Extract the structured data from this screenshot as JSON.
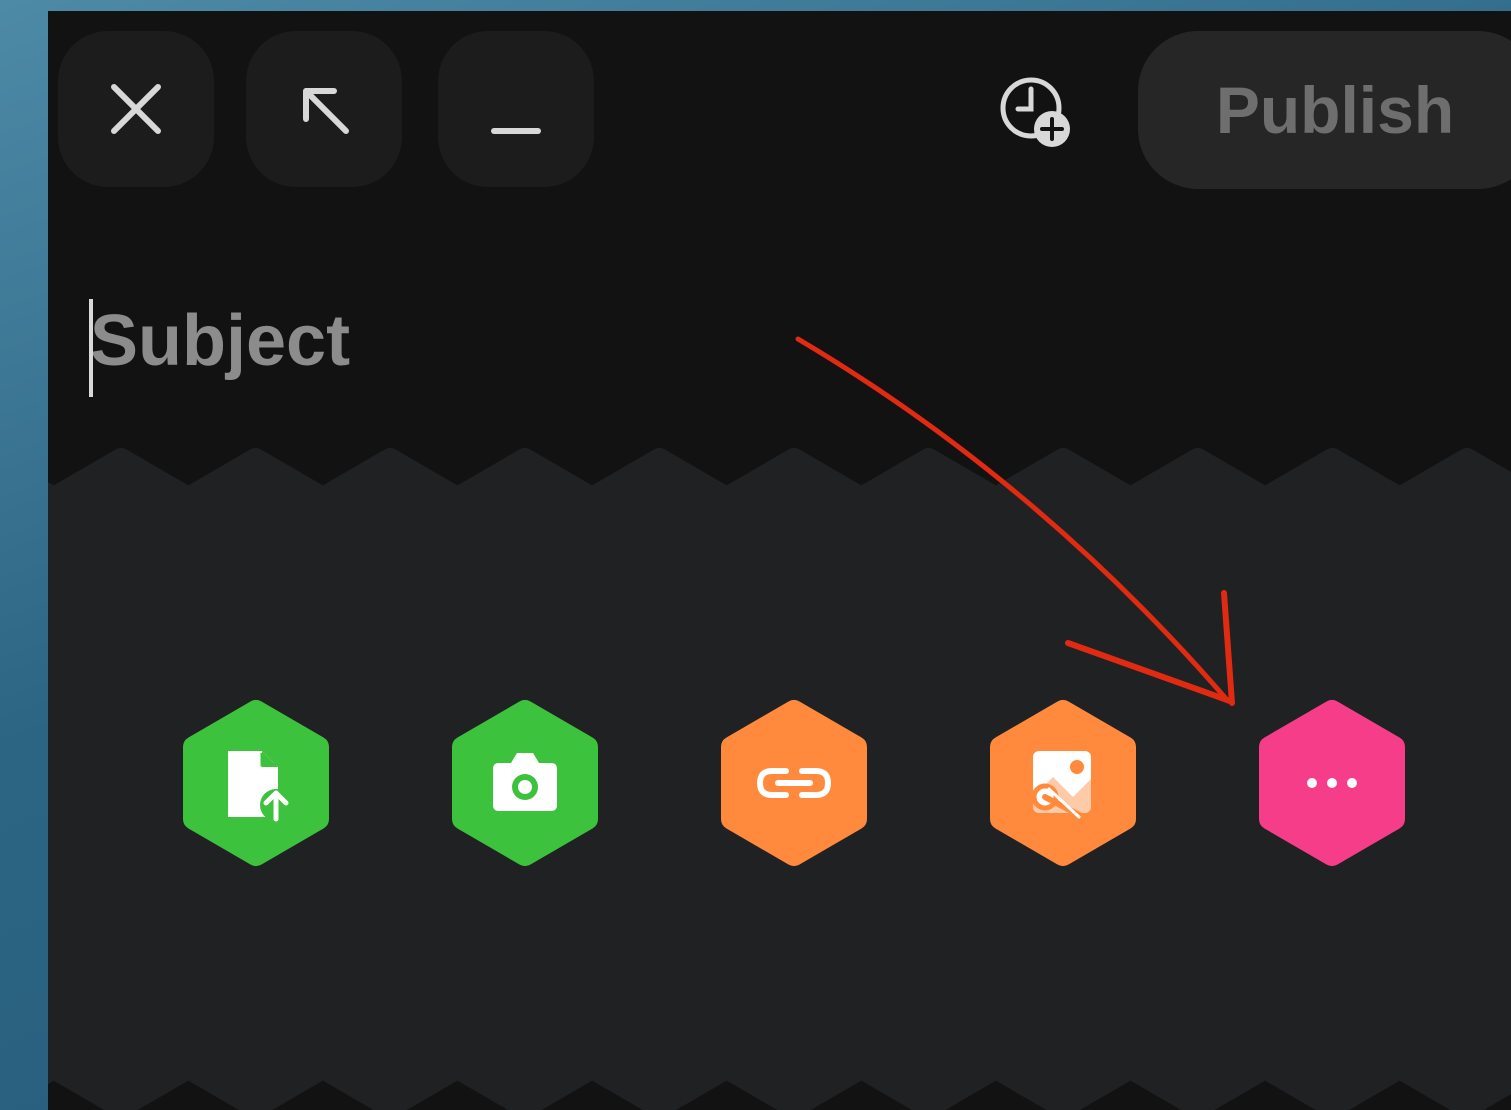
{
  "toolbar": {
    "close_icon": "close-icon",
    "expand_icon": "expand-arrow-icon",
    "minimize_icon": "minimize-icon",
    "schedule_icon": "clock-add-icon",
    "publish_label": "Publish"
  },
  "subject": {
    "value": "",
    "placeholder": "Subject"
  },
  "actions": [
    {
      "icon": "file-upload-icon",
      "color": "#3dc23d"
    },
    {
      "icon": "camera-icon",
      "color": "#3dc23d"
    },
    {
      "icon": "link-icon",
      "color": "#ff8a3d"
    },
    {
      "icon": "image-edit-icon",
      "color": "#ff8a3d"
    },
    {
      "icon": "more-icon",
      "color": "#f53d8a"
    }
  ],
  "colors": {
    "window_bg": "#121212",
    "hex_bg": "#202123",
    "green": "#3dc23d",
    "orange": "#ff8a3d",
    "pink": "#f53d8a",
    "annotation_arrow": "#e02a12"
  }
}
